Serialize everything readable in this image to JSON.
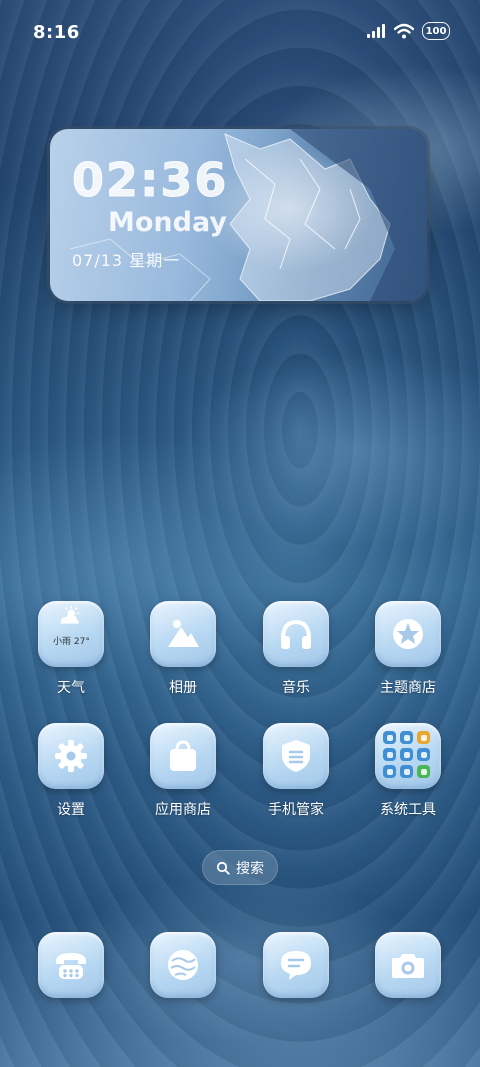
{
  "status_bar": {
    "time": "8:16",
    "battery": "100"
  },
  "clock_widget": {
    "time": "02:36",
    "day": "Monday",
    "date": "07/13 星期一"
  },
  "apps": [
    {
      "label": "天气",
      "icon": "weather-icon",
      "weather_text": "小雨 27°"
    },
    {
      "label": "相册",
      "icon": "gallery-icon"
    },
    {
      "label": "音乐",
      "icon": "headphones-icon"
    },
    {
      "label": "主题商店",
      "icon": "theme-store-icon"
    },
    {
      "label": "设置",
      "icon": "gear-icon"
    },
    {
      "label": "应用商店",
      "icon": "shopping-bag-icon"
    },
    {
      "label": "手机管家",
      "icon": "shield-icon"
    },
    {
      "label": "系统工具",
      "icon": "folder-icon"
    }
  ],
  "search": {
    "label": "搜索",
    "icon": "search-icon"
  },
  "dock": [
    {
      "icon": "phone-icon",
      "name": "phone"
    },
    {
      "icon": "browser-icon",
      "name": "browser"
    },
    {
      "icon": "messages-icon",
      "name": "messages"
    },
    {
      "icon": "camera-icon",
      "name": "camera"
    }
  ],
  "colors": {
    "icon_glyph": "#ffffff",
    "folder_tile": "#3f8fd2"
  }
}
